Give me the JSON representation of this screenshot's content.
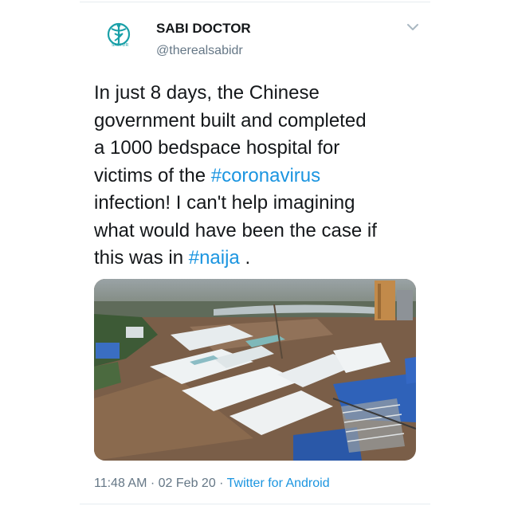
{
  "tweet": {
    "display_name": "SABI DOCTOR",
    "handle": "@therealsabidr",
    "avatar_label": "SABI DR",
    "text_lines": [
      {
        "before": "In just 8 days, the Chinese",
        "hashtag": "",
        "after": ""
      },
      {
        "before": "government built and completed",
        "hashtag": "",
        "after": ""
      },
      {
        "before": "a 1000 bedspace hospital for",
        "hashtag": "",
        "after": ""
      },
      {
        "before": "victims of the ",
        "hashtag": "#coronavirus",
        "after": ""
      },
      {
        "before": "infection! I can't help imagining",
        "hashtag": "",
        "after": ""
      },
      {
        "before": "what would have been the case if",
        "hashtag": "",
        "after": ""
      },
      {
        "before": "this was in ",
        "hashtag": "#naija",
        "after": " ."
      }
    ],
    "time": "11:48 AM",
    "separator": "·",
    "date": "02 Feb 20",
    "source": "Twitter for Android"
  },
  "colors": {
    "link": "#1b95e0",
    "secondary_text": "#657786",
    "primary_text": "#14171a",
    "avatar_accent": "#1aa0a8"
  },
  "icons": {
    "avatar": "caduceus-logo-icon",
    "menu": "chevron-down-icon"
  }
}
